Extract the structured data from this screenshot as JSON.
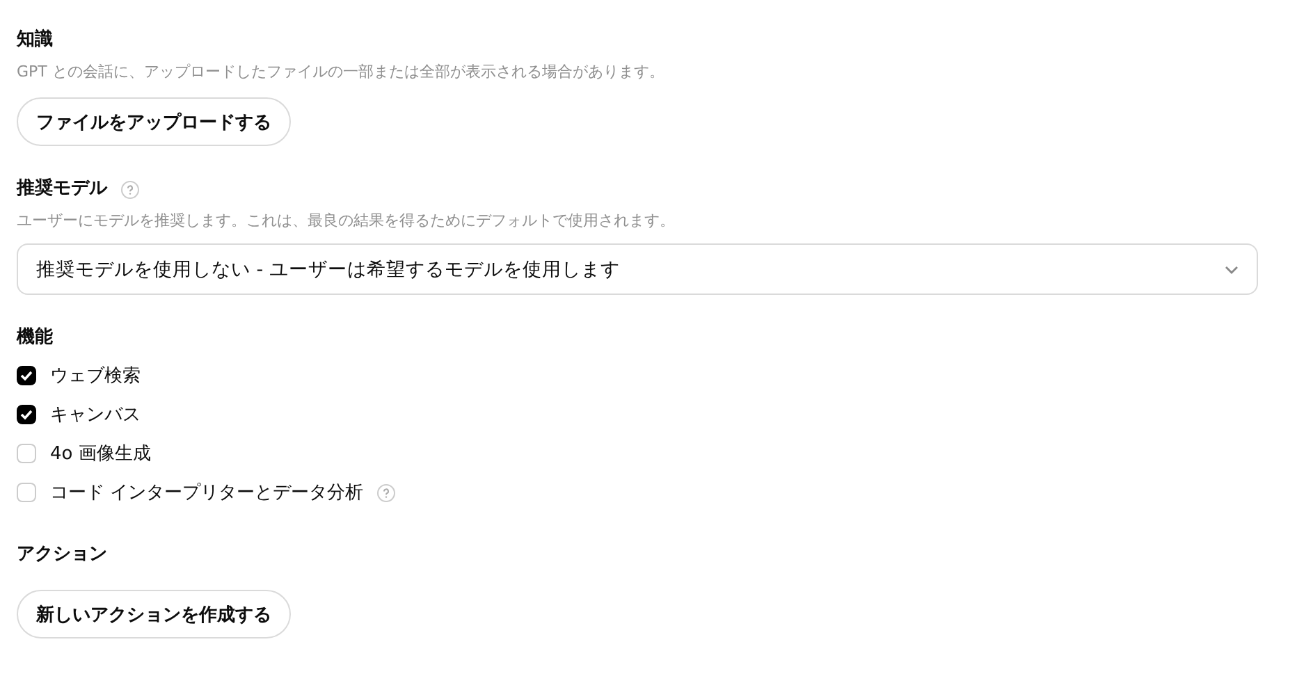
{
  "knowledge": {
    "heading": "知識",
    "description": "GPT との会話に、アップロードしたファイルの一部または全部が表示される場合があります。",
    "button": "ファイルをアップロードする"
  },
  "recommended_model": {
    "heading": "推奨モデル",
    "help": true,
    "description": "ユーザーにモデルを推奨します。これは、最良の結果を得るためにデフォルトで使用されます。",
    "select_value": "推奨モデルを使用しない - ユーザーは希望するモデルを使用します"
  },
  "capabilities": {
    "heading": "機能",
    "items": [
      {
        "label": "ウェブ検索",
        "checked": true,
        "help": false
      },
      {
        "label": "キャンバス",
        "checked": true,
        "help": false
      },
      {
        "label": "4o 画像生成",
        "checked": false,
        "help": false
      },
      {
        "label": "コード インタープリターとデータ分析",
        "checked": false,
        "help": true
      }
    ]
  },
  "actions": {
    "heading": "アクション",
    "button": "新しいアクションを作成する"
  }
}
